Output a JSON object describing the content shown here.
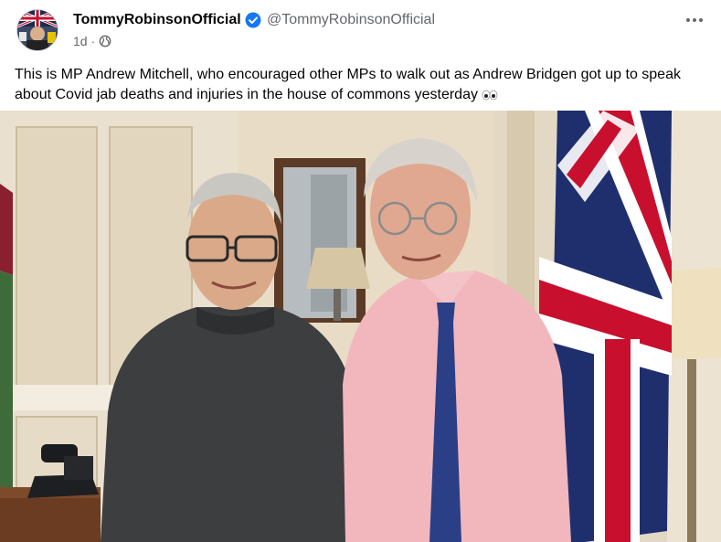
{
  "post": {
    "author_name": "TommyRobinsonOfficial",
    "author_handle": "@TommyRobinsonOfficial",
    "timestamp": "1d",
    "separator": "·",
    "privacy_icon": "public-globe-icon",
    "more_icon": "more-horizontal-icon",
    "body_text": "This is MP Andrew Mitchell, who encouraged other MPs to walk out as Andrew Bridgen got up to speak about Covid jab deaths and injuries in the house of commons yesterday",
    "body_emoji": "eyes-emoji",
    "verified_color": "#1877f2"
  },
  "photo": {
    "description_icon": "post-photo"
  }
}
